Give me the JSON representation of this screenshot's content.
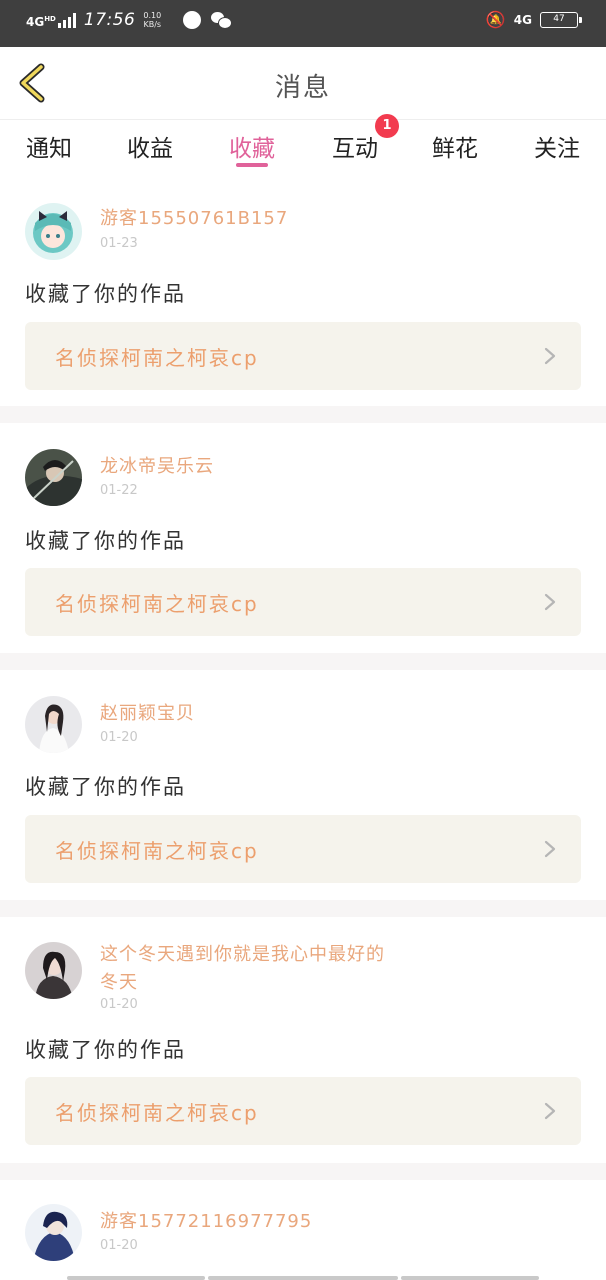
{
  "status_bar": {
    "network": "4G",
    "network_sup": "HD",
    "time": "17:56",
    "speed_value": "0.10",
    "speed_unit": "KB/s",
    "right_network": "4G",
    "battery_level": "47"
  },
  "header": {
    "back_icon": "chevron-left-icon",
    "title": "消息"
  },
  "tabs": [
    {
      "label": "通知"
    },
    {
      "label": "收益"
    },
    {
      "label": "收藏"
    },
    {
      "label": "互动",
      "badge": "1"
    },
    {
      "label": "鲜花"
    },
    {
      "label": "关注"
    }
  ],
  "active_tab": "收藏",
  "colors": {
    "accent_pink": "#e0629a",
    "username_orange": "#e9a77d",
    "work_title_orange": "#ec9f6d",
    "badge_red": "#f23b4f",
    "work_bg": "#f5f3ec"
  },
  "messages": [
    {
      "username": "游客15550761B157",
      "time": "01-23",
      "action": "收藏了你的作品",
      "work_title": "名侦探柯南之柯哀cp"
    },
    {
      "username": "龙冰帝吴乐云",
      "time": "01-22",
      "action": "收藏了你的作品",
      "work_title": "名侦探柯南之柯哀cp"
    },
    {
      "username": "赵丽颖宝贝",
      "time": "01-20",
      "action": "收藏了你的作品",
      "work_title": "名侦探柯南之柯哀cp"
    },
    {
      "username": "这个冬天遇到你就是我心中最好的冬天",
      "time": "01-20",
      "action": "收藏了你的作品",
      "work_title": "名侦探柯南之柯哀cp"
    },
    {
      "username": "游客15772116977795",
      "time": "01-20"
    }
  ]
}
